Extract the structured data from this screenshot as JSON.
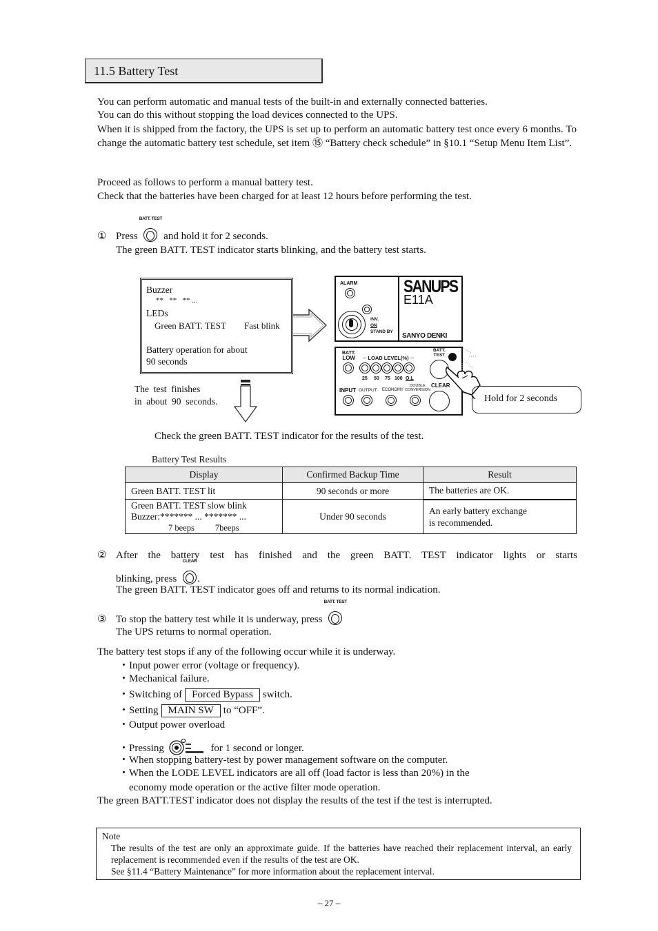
{
  "section": {
    "title": "11.5 Battery Test"
  },
  "intro": {
    "lines": [
      "You can perform automatic and manual tests of the built-in and externally connected batteries.",
      "You can do this without stopping the load devices connected to the UPS.",
      "When it is shipped from the factory, the UPS is set up to perform an automatic battery test once every 6 months. To change the automatic battery test schedule, set item ⑮ “Battery check schedule” in §10.1 “Setup Menu Item List”."
    ],
    "manual_lines": [
      "Proceed as follows to perform a manual battery test.",
      "Check that the batteries have been charged for at least 12 hours before performing the test."
    ]
  },
  "step1": {
    "num": "①",
    "pre": "Press",
    "button_label": "BATT. TEST",
    "post": "and hold it for 2 seconds.",
    "detail": "The green BATT. TEST indicator starts blinking, and the battery test starts."
  },
  "diagram": {
    "info_box": {
      "buzzer_label": "Buzzer",
      "buzzer_pattern": "**   **   ** ...",
      "leds_label": "LEDs",
      "led_name": "Green BATT. TEST",
      "led_state": "Fast blink",
      "battery_line1": "Battery operation for about",
      "battery_line2": "90 seconds"
    },
    "finish_line1": "The  test  finishes",
    "finish_line2": "in  about  90  seconds.",
    "panel": {
      "alarm": "ALARM",
      "inv": "INV.",
      "on": "ON",
      "standby": "STAND BY",
      "brand": "SANUPS",
      "model": "E11A",
      "maker": "SANYO DENKI",
      "batt_low": [
        "BATT.",
        "LOW"
      ],
      "load_level": "LOAD LEVEL(%)",
      "load_levels": [
        "25",
        "50",
        "75",
        "100",
        "O.L"
      ],
      "batt_test": [
        "BATT.",
        "TEST"
      ],
      "input": "INPUT",
      "output": "OUTPUT",
      "economy": "ECONOMY",
      "double_conversion": [
        "DOUBLE",
        "CONVERSION"
      ],
      "clear": "CLEAR"
    },
    "callout": "Hold for 2 seconds",
    "check_text": "Check the green BATT. TEST indicator for the results of the test."
  },
  "results_table": {
    "caption": "Battery Test Results",
    "headers": [
      "Display",
      "Confirmed Backup Time",
      "Result"
    ],
    "rows": [
      {
        "display": [
          "Green BATT. TEST lit"
        ],
        "time": "90 seconds or more",
        "result": [
          "The batteries are OK."
        ]
      },
      {
        "display": [
          "Green BATT. TEST slow blink",
          "Buzzer:******* ... ******* ..."
        ],
        "beeps": [
          "7 beeps",
          "7beeps"
        ],
        "time": "Under 90 seconds",
        "result": [
          "An early battery exchange",
          "is recommended."
        ]
      }
    ]
  },
  "step2": {
    "num": "②",
    "line1": "After the battery test has finished and the green BATT. TEST indicator lights or starts",
    "pre": "blinking, press",
    "button_label": "CLEAR",
    "post": ".",
    "detail": "The green BATT. TEST indicator goes off and returns to its normal indication."
  },
  "step3": {
    "num": "③",
    "pre": "To stop the battery test while it is underway, press",
    "button_label": "BATT. TEST",
    "detail": "The UPS returns to normal operation."
  },
  "stops": {
    "intro": "The battery test stops if any of the following occur while it is underway.",
    "bullet": "・",
    "items": [
      "Input power error (voltage or frequency).",
      "Mechanical failure."
    ],
    "forced_bypass": {
      "pre": "Switching of",
      "key": "Forced Bypass",
      "post": "switch."
    },
    "main_sw": {
      "pre": "Setting",
      "key": "MAIN SW",
      "post": "to “OFF”."
    },
    "overload": "Output power overload",
    "pressing": {
      "pre": "Pressing",
      "post": "for 1 second or longer."
    },
    "software": "When stopping battery-test by power management software on the computer.",
    "lode_line1": "When the LODE LEVEL indicators are all off (load factor is less than 20%) in the",
    "lode_line2": "economy mode operation or the active filter mode operation.",
    "interrupted": "The green BATT.TEST indicator does not display the results of the test if the test is interrupted."
  },
  "note": {
    "label": "Note",
    "text": "The results of the test are only an approximate guide. If the batteries have reached their replacement interval, an early replacement is recommended even if the results of the test are OK.",
    "see": "See §11.4 “Battery Maintenance” for more information about the replacement interval."
  },
  "footer": {
    "page": "– 27 –"
  }
}
